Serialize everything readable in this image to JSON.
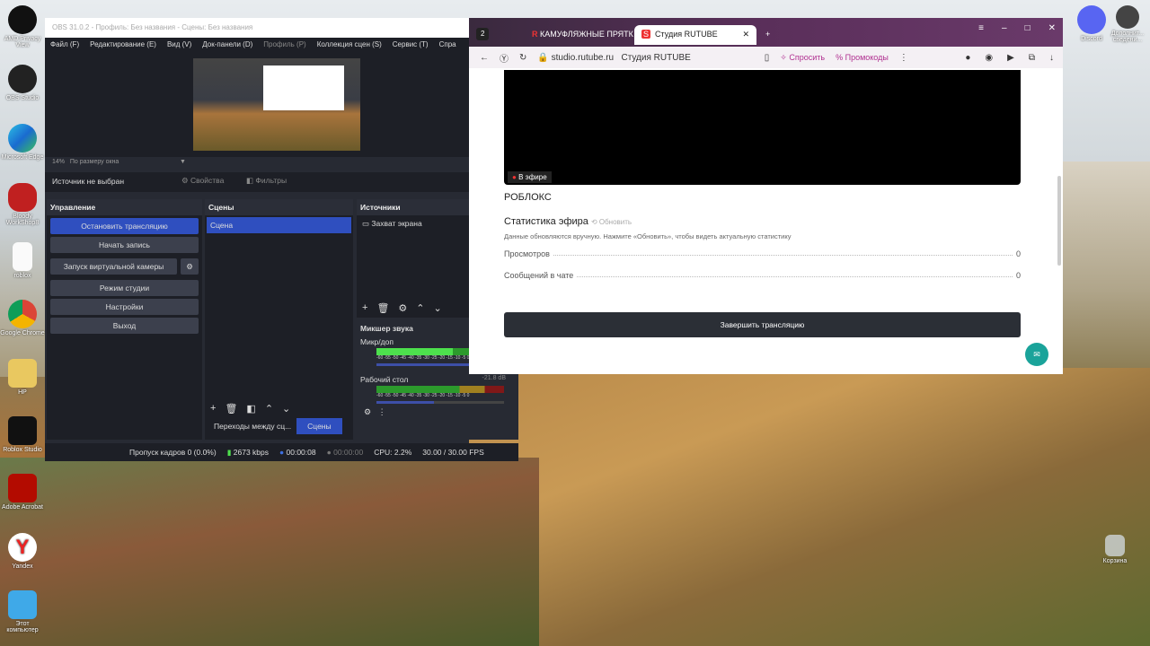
{
  "desktop": {
    "icons_left": [
      "AMD Privacy View",
      "OBS Studio",
      "Microsoft Edge",
      "Bloody WorkShop8",
      "roblox",
      "Google Chrome",
      "HP",
      "Roblox Studio",
      "Adobe Acrobat",
      "Yandex",
      "Этот компьютер"
    ],
    "icons_right": [
      "Discord",
      "Дополнит... сведени..."
    ],
    "recycle": "Корзина"
  },
  "obs": {
    "title": "OBS 31.0.2 - Профиль: Без названия - Сцены: Без названия",
    "menu": [
      "Файл (F)",
      "Редактирование (E)",
      "Вид (V)",
      "Док-панели (D)",
      "Профиль (P)",
      "Коллекция сцен (S)",
      "Сервис (T)",
      "Спра"
    ],
    "zoom": "14%",
    "zoom_mode": "По размеру окна",
    "no_source": "Источник не выбран",
    "properties": "Свойства",
    "filters": "Фильтры",
    "controls": {
      "title": "Управление",
      "buttons": [
        "Остановить трансляцию",
        "Начать запись",
        "Запуск виртуальной камеры",
        "Режим студии",
        "Настройки",
        "Выход"
      ]
    },
    "scenes": {
      "title": "Сцены",
      "items": [
        "Сцена"
      ]
    },
    "sources": {
      "title": "Источники",
      "items": [
        "Захват экрана"
      ]
    },
    "mixer": {
      "title": "Микшер звука",
      "channels": [
        {
          "name": "Микр/доп",
          "db": ""
        },
        {
          "name": "Рабочий стол",
          "db": "-21.8 dB"
        }
      ],
      "scale": "-60 -55 -50 -45 -40 -35 -30 -25 -20 -15 -10 -5 0"
    },
    "tabs": [
      "Переходы между сц...",
      "Сцены"
    ],
    "status": {
      "dropped": "Пропуск кадров 0 (0.0%)",
      "bitrate": "2673 kbps",
      "stream_time": "00:00:08",
      "rec_time": "00:00:00",
      "cpu": "CPU: 2.2%",
      "fps": "30.00 / 30.00 FPS"
    }
  },
  "browser": {
    "tab_count": "2",
    "tabs": [
      "КАМУФЛЯЖНЫЕ ПРЯТК",
      "Студия RUTUBE"
    ],
    "url": "studio.rutube.ru",
    "page_title": "Студия RUTUBE",
    "ask": "Спросить",
    "promo": "Промокоды",
    "page": {
      "live_badge": "В эфире",
      "stream_name": "РОБЛОКС",
      "stats_title": "Статистика эфира",
      "refresh": "Обновить",
      "note": "Данные обновляются вручную. Нажмите «Обновить», чтобы видеть актуальную статистику",
      "stats": [
        {
          "label": "Просмотров",
          "value": "0"
        },
        {
          "label": "Сообщений в чате",
          "value": "0"
        }
      ],
      "end_button": "Завершить трансляцию"
    }
  }
}
